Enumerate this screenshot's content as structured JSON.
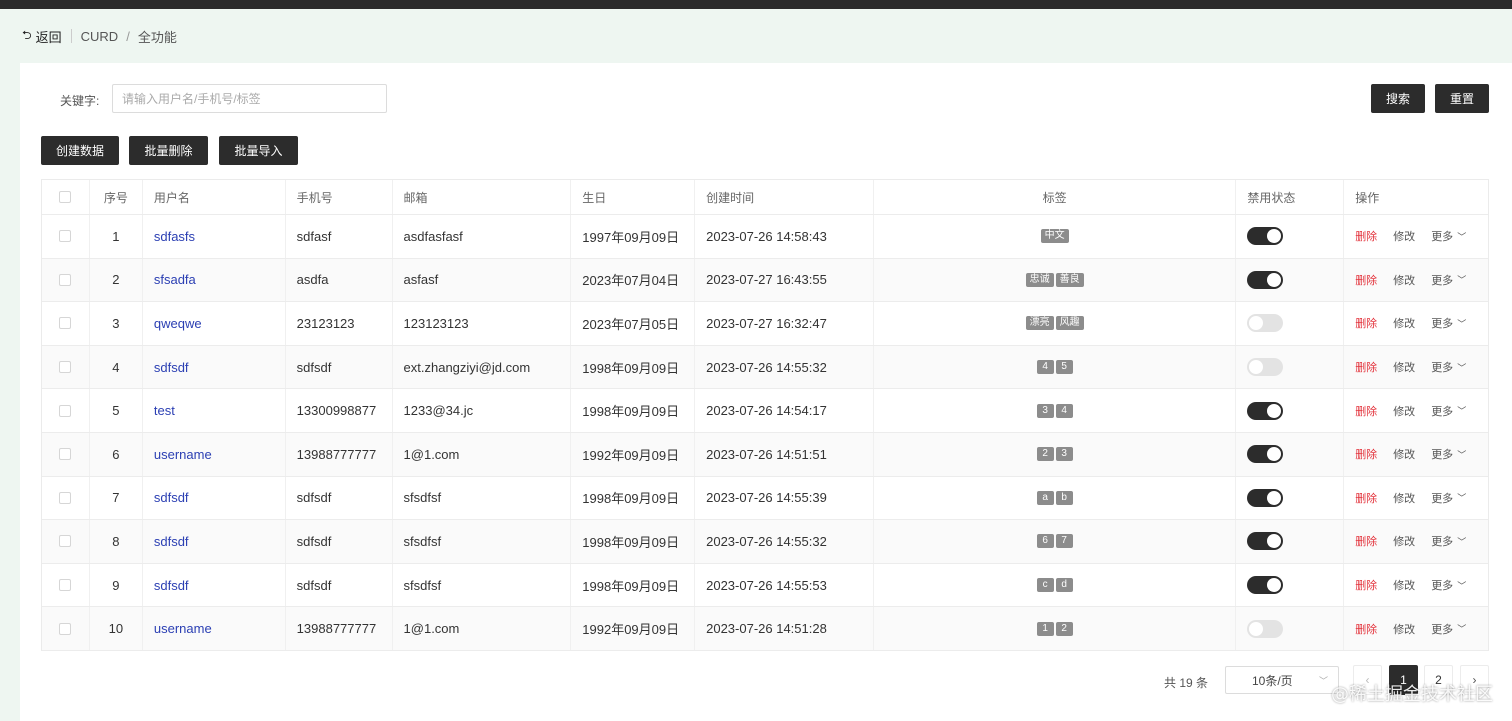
{
  "breadcrumb": {
    "back_icon": "return-arrow-icon",
    "back_label": "返回",
    "path1": "CURD",
    "sep": "/",
    "path2": "全功能"
  },
  "search": {
    "label": "关键字:",
    "placeholder": "请输入用户名/手机号/标签",
    "value": "",
    "search_btn": "搜索",
    "reset_btn": "重置"
  },
  "toolbar": {
    "create": "创建数据",
    "batch_delete": "批量删除",
    "batch_import": "批量导入"
  },
  "table": {
    "headers": [
      "",
      "序号",
      "用户名",
      "手机号",
      "邮箱",
      "生日",
      "创建时间",
      "标签",
      "禁用状态",
      "操作"
    ],
    "rows": [
      {
        "no": "1",
        "username": "sdfasfs",
        "phone": "sdfasf",
        "email": "asdfasfasf",
        "birthday": "1997年09月09日",
        "created": "2023-07-26 14:58:43",
        "tags": [
          "中文"
        ],
        "disabled": true
      },
      {
        "no": "2",
        "username": "sfsadfa",
        "phone": "asdfa",
        "email": "asfasf",
        "birthday": "2023年07月04日",
        "created": "2023-07-27 16:43:55",
        "tags": [
          "忠诚",
          "善良"
        ],
        "disabled": true
      },
      {
        "no": "3",
        "username": "qweqwe",
        "phone": "23123123",
        "email": "123123123",
        "birthday": "2023年07月05日",
        "created": "2023-07-27 16:32:47",
        "tags": [
          "漂亮",
          "风趣"
        ],
        "disabled": false
      },
      {
        "no": "4",
        "username": "sdfsdf",
        "phone": "sdfsdf",
        "email": "ext.zhangziyi@jd.com",
        "birthday": "1998年09月09日",
        "created": "2023-07-26 14:55:32",
        "tags": [
          "4",
          "5"
        ],
        "disabled": false
      },
      {
        "no": "5",
        "username": "test",
        "phone": "13300998877",
        "email": "1233@34.jc",
        "birthday": "1998年09月09日",
        "created": "2023-07-26 14:54:17",
        "tags": [
          "3",
          "4"
        ],
        "disabled": true
      },
      {
        "no": "6",
        "username": "username",
        "phone": "13988777777",
        "email": "1@1.com",
        "birthday": "1992年09月09日",
        "created": "2023-07-26 14:51:51",
        "tags": [
          "2",
          "3"
        ],
        "disabled": true
      },
      {
        "no": "7",
        "username": "sdfsdf",
        "phone": "sdfsdf",
        "email": "sfsdfsf",
        "birthday": "1998年09月09日",
        "created": "2023-07-26 14:55:39",
        "tags": [
          "a",
          "b"
        ],
        "disabled": true
      },
      {
        "no": "8",
        "username": "sdfsdf",
        "phone": "sdfsdf",
        "email": "sfsdfsf",
        "birthday": "1998年09月09日",
        "created": "2023-07-26 14:55:32",
        "tags": [
          "6",
          "7"
        ],
        "disabled": true
      },
      {
        "no": "9",
        "username": "sdfsdf",
        "phone": "sdfsdf",
        "email": "sfsdfsf",
        "birthday": "1998年09月09日",
        "created": "2023-07-26 14:55:53",
        "tags": [
          "c",
          "d"
        ],
        "disabled": true
      },
      {
        "no": "10",
        "username": "username",
        "phone": "13988777777",
        "email": "1@1.com",
        "birthday": "1992年09月09日",
        "created": "2023-07-26 14:51:28",
        "tags": [
          "1",
          "2"
        ],
        "disabled": false
      }
    ],
    "actions": {
      "delete": "删除",
      "edit": "修改",
      "more": "更多"
    }
  },
  "pagination": {
    "total": "共 19 条",
    "page_size": "10条/页",
    "prev": "‹",
    "pages": [
      "1",
      "2"
    ],
    "current": "1",
    "next": "›"
  },
  "watermark": "@稀土掘金技术社区",
  "colors": {
    "primary_dark": "#2c2c2c",
    "link": "#2b3fb3",
    "danger": "#e3323b",
    "tag_bg": "#8c8c8c",
    "page_bg": "#eef6f1"
  }
}
